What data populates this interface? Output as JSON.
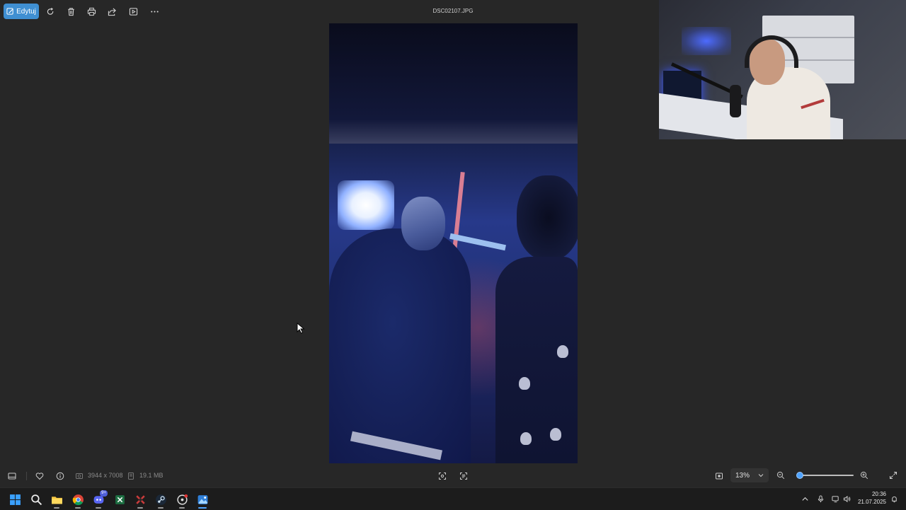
{
  "toolbar": {
    "edit_label": "Edytuj",
    "icons": [
      "rotate-icon",
      "delete-icon",
      "print-icon",
      "share-icon",
      "slideshow-icon",
      "more-icon"
    ]
  },
  "file": {
    "name": "DSC02107.JPG"
  },
  "info": {
    "dimensions": "3944 x 7008",
    "size": "19.1 MB"
  },
  "zoom": {
    "value": "13%",
    "slider_fraction": 0.05
  },
  "clock": {
    "time": "20:36",
    "date": "21.07.2025"
  },
  "taskbar": {
    "apps": [
      "windows-start-icon",
      "search-icon",
      "file-explorer-icon",
      "chrome-icon",
      "discord-icon",
      "excel-icon",
      "game-icon",
      "steam-icon",
      "media-icon",
      "photos-app-icon"
    ],
    "discord_badge": "9+"
  },
  "colors": {
    "accent": "#3f8fd2",
    "background": "#272727",
    "taskbar": "#1c1c1c"
  }
}
